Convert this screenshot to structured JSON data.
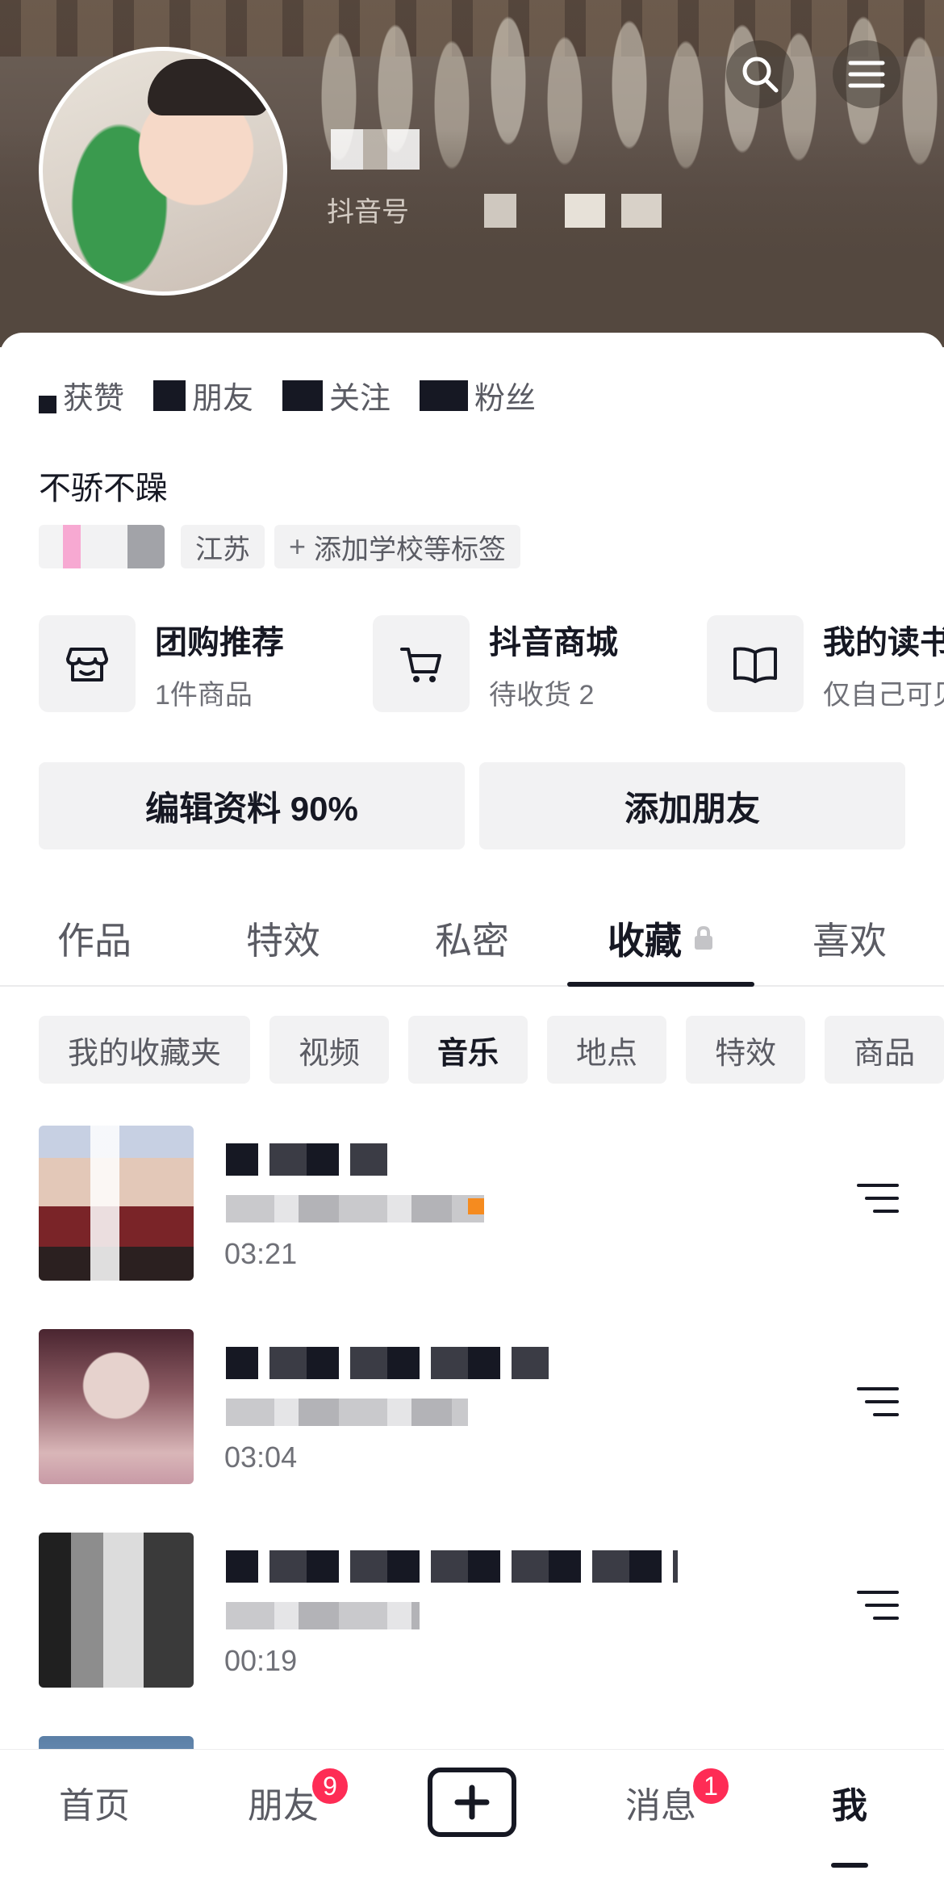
{
  "header": {
    "search_icon": "search-icon",
    "menu_icon": "menu-icon",
    "douyin_id_label": "抖音号"
  },
  "stats": [
    {
      "label": "获赞"
    },
    {
      "label": "朋友"
    },
    {
      "label": "关注"
    },
    {
      "label": "粉丝"
    }
  ],
  "profile": {
    "signature": "不骄不躁",
    "tags": [
      "江苏",
      "添加学校等标签"
    ]
  },
  "shortcuts": [
    {
      "title": "团购推荐",
      "subtitle": "1件商品",
      "icon": "store-icon"
    },
    {
      "title": "抖音商城",
      "subtitle": "待收货 2",
      "icon": "cart-icon"
    },
    {
      "title": "我的读书",
      "subtitle": "仅自己可见",
      "icon": "book-icon"
    }
  ],
  "actions": {
    "edit_profile": "编辑资料 90%",
    "add_friend": "添加朋友"
  },
  "tabs": [
    {
      "label": "作品"
    },
    {
      "label": "特效"
    },
    {
      "label": "私密"
    },
    {
      "label": "收藏",
      "active": true,
      "locked": true
    },
    {
      "label": "喜欢"
    }
  ],
  "chips": [
    {
      "label": "我的收藏夹"
    },
    {
      "label": "视频"
    },
    {
      "label": "音乐",
      "active": true
    },
    {
      "label": "地点"
    },
    {
      "label": "特效"
    },
    {
      "label": "商品"
    }
  ],
  "music": [
    {
      "duration": "03:21"
    },
    {
      "duration": "03:04"
    },
    {
      "duration": "00:19"
    },
    {
      "duration": ""
    }
  ],
  "bottom_nav": {
    "home": "首页",
    "friends": "朋友",
    "friends_badge": "9",
    "messages": "消息",
    "messages_badge": "1",
    "me": "我"
  },
  "colors": {
    "text_primary": "#161823",
    "text_secondary": "#5a5b63",
    "badge": "#fe2c55",
    "chip_bg": "#f2f2f3"
  }
}
